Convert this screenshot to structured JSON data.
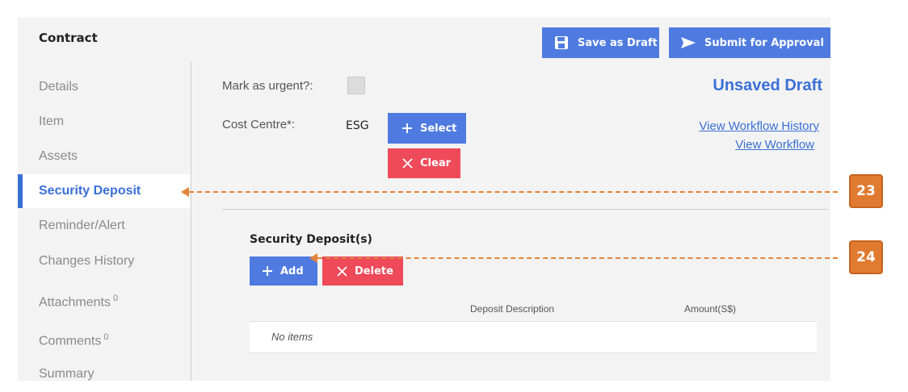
{
  "header": {
    "title": "Contract",
    "save_draft_label": "Save as Draft",
    "submit_label": "Submit for Approval"
  },
  "sidebar": {
    "items": [
      {
        "label": "Details"
      },
      {
        "label": "Item"
      },
      {
        "label": "Assets"
      },
      {
        "label": "Security Deposit",
        "active": true
      },
      {
        "label": "Reminder/Alert"
      },
      {
        "label": "Changes History"
      },
      {
        "label": "Attachments",
        "count": "0"
      },
      {
        "label": "Comments",
        "count": "0"
      },
      {
        "label": "Summary"
      }
    ]
  },
  "form": {
    "urgent_label": "Mark as urgent?:",
    "urgent_checked": false,
    "cost_centre_label": "Cost Centre*:",
    "cost_centre_value": "ESG",
    "select_label": "Select",
    "clear_label": "Clear"
  },
  "status": {
    "title": "Unsaved Draft",
    "workflow_history_link": "View Workflow History",
    "workflow_link": "View Workflow"
  },
  "deposits": {
    "section_title": "Security Deposit(s)",
    "add_label": "Add",
    "delete_label": "Delete",
    "columns": [
      "Deposit Description",
      "Amount(S$)"
    ],
    "empty_text": "No items"
  },
  "callouts": [
    {
      "number": "23"
    },
    {
      "number": "24"
    }
  ],
  "colors": {
    "accent": "#3a6fd6",
    "button_blue": "#4f7be0",
    "button_red": "#ee4a5a",
    "callout": "#e07a31"
  }
}
